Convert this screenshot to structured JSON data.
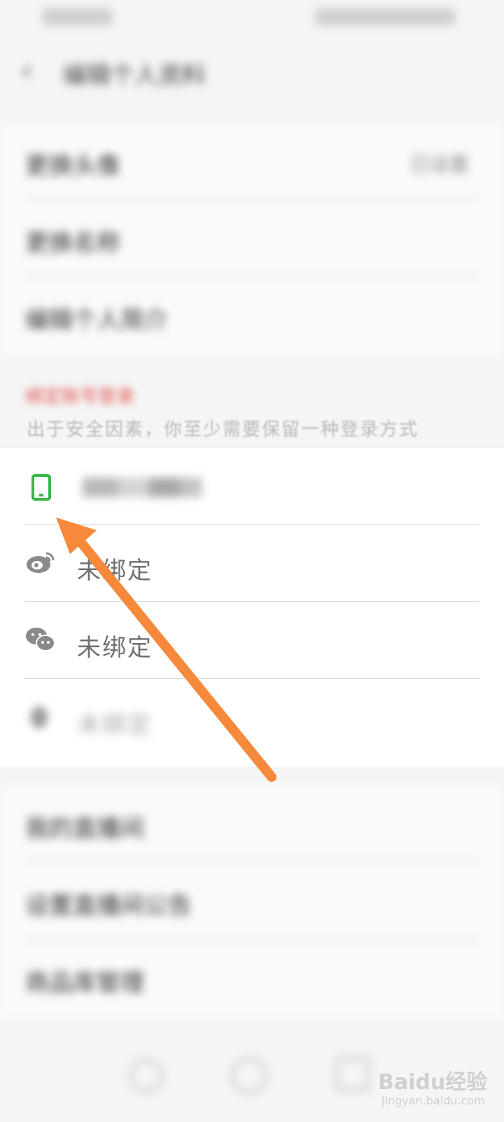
{
  "status_bar": {},
  "header": {
    "title": "编辑个人资料",
    "back_icon": "back-arrow-icon"
  },
  "menu": {
    "items": [
      {
        "label": "更换头像",
        "value": "已设置"
      },
      {
        "label": "更换名称"
      },
      {
        "label": "编辑个人简介"
      }
    ]
  },
  "notice": {
    "red_text": "绑定账号登录",
    "gray_text": "出于安全因素，你至少需要保留一种登录方式"
  },
  "bindings": [
    {
      "icon": "phone-icon",
      "text": "",
      "status": "masked-number"
    },
    {
      "icon": "weibo-icon",
      "text": "未绑定"
    },
    {
      "icon": "wechat-icon",
      "text": "未绑定"
    },
    {
      "icon": "qq-icon",
      "text": "未绑定"
    }
  ],
  "lower_menu": {
    "items": [
      {
        "label": "我的直播间"
      },
      {
        "label": "设置直播间公告"
      },
      {
        "label": "商品库管理"
      }
    ]
  },
  "watermark": {
    "brand": "Baidu经验",
    "url": "jingyan.baidu.com"
  },
  "colors": {
    "accent_green": "#3bb54a",
    "arrow_orange": "#f6893b",
    "notice_red": "#e0554f"
  }
}
